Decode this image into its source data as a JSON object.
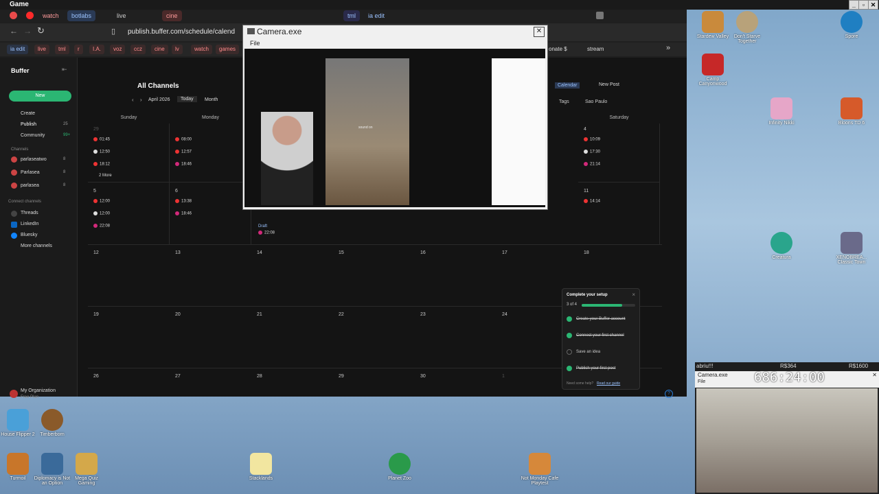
{
  "game_bar": {
    "title": "Game"
  },
  "tabs": [
    "watch",
    "botlabs",
    "live",
    "cine",
    "tml",
    "ia edit"
  ],
  "address": {
    "url": "publish.buffer.com/schedule/calend"
  },
  "bookmarks": [
    "ia edit",
    "live",
    "tml",
    "r",
    "I.A.",
    "voz",
    "ccz",
    "cine",
    "lv",
    "watch",
    "games",
    "onate $",
    "stream"
  ],
  "buffer": {
    "brand": "Buffer",
    "new_button": "New",
    "nav": [
      {
        "label": "Create",
        "count": ""
      },
      {
        "label": "Publish",
        "count": "25"
      },
      {
        "label": "Community",
        "count": "99+"
      }
    ],
    "channels_heading": "Channels",
    "channels": [
      {
        "label": "parlaseatwo",
        "count": "8"
      },
      {
        "label": "Parlasea",
        "count": "8"
      },
      {
        "label": "parlasea",
        "count": "8"
      }
    ],
    "connect_heading": "Connect channels",
    "connect": [
      "Threads",
      "LinkedIn",
      "Bluesky",
      "More channels"
    ],
    "org": {
      "name": "My Organization",
      "plan": "Free Plan"
    }
  },
  "calendar": {
    "title": "All Channels",
    "month": "April 2026",
    "today": "Today",
    "view": "Month",
    "calendar_btn": "Calendar",
    "new_post": "New Post",
    "tags": "Tags",
    "timezone": "Sao Paulo",
    "days": [
      "Sunday",
      "Monday",
      "",
      "",
      "",
      "",
      "Saturday"
    ],
    "week1_posts": {
      "sunday": [
        "01:45",
        "12:50",
        "18:12"
      ],
      "monday": [
        "08:00",
        "12:57",
        "18:46"
      ],
      "saturday": [
        "10:09",
        "17:30",
        "21:14"
      ],
      "more": "2 More"
    },
    "week2_posts": {
      "sunday": [
        "12:00",
        "12:00",
        "22:08"
      ],
      "monday": [
        "13:38",
        "18:46"
      ],
      "wednesday_draft": "Draft",
      "wednesday_time": "22:08",
      "saturday": [
        "14:14"
      ]
    },
    "dates": {
      "row1": [
        "29",
        "",
        "",
        "",
        "",
        "",
        "4"
      ],
      "row2": [
        "5",
        "6",
        "",
        "",
        "",
        "",
        "11"
      ],
      "row3": [
        "12",
        "13",
        "14",
        "15",
        "16",
        "17",
        "18"
      ],
      "row4": [
        "19",
        "20",
        "21",
        "22",
        "23",
        "24",
        ""
      ],
      "row5": [
        "26",
        "27",
        "28",
        "29",
        "30",
        "1",
        ""
      ]
    }
  },
  "camera_window": {
    "title": "Camera.exe",
    "menu": "File",
    "sound": "sound on"
  },
  "setup_card": {
    "title": "Complete your setup",
    "progress_text": "3 of 4",
    "progress": 0.75,
    "steps": [
      "Create your Buffer account",
      "Connect your first channel",
      "Save an idea",
      "Publish your first post"
    ],
    "help": "Need some help?",
    "help_link": "Read our guide"
  },
  "desktop_icons": [
    "Stardew Valley",
    "Don't Starve Together",
    "Spore",
    "Camp Canyonwood",
    "Infinity Nikki",
    "Bloons TD 6",
    "Creatura",
    "XENOBREA... Classic Town",
    "House Flipper 2",
    "Timberborn",
    "Turmoil",
    "Diplomacy is Not an Option",
    "Mega Quiz Gaming",
    "Stacklands",
    "Planet Zoo",
    "Not Monday Cafe Playtest"
  ],
  "stream_panel": {
    "label": "abriu!!!",
    "r1": "R$364",
    "r2": "R$1600",
    "timer": "686:24:00",
    "cam_title": "Camera.exe",
    "menu": "File"
  }
}
